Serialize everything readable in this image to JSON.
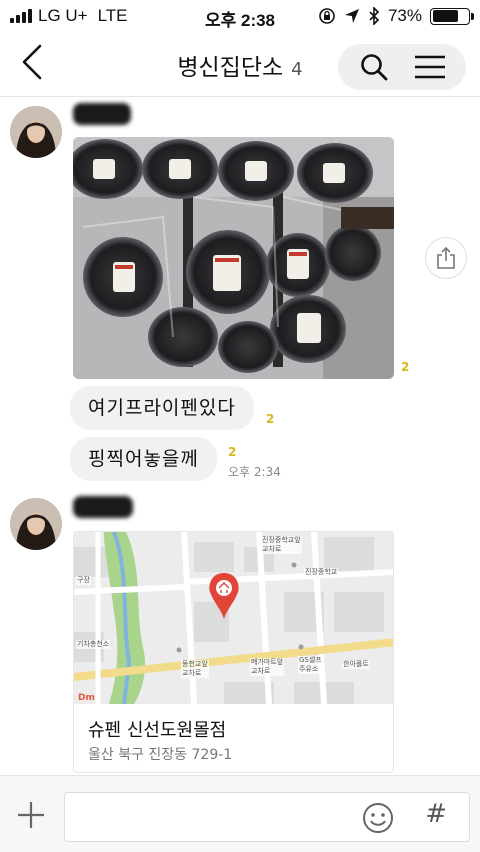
{
  "status_bar": {
    "carrier": "LG U+",
    "network": "LTE",
    "time": "오후 2:38",
    "battery_text": "73%",
    "battery_level": 0.73
  },
  "header": {
    "title": "병신집단소",
    "member_count": "4",
    "icons": [
      "back-arrow-icon",
      "search-icon",
      "menu-icon"
    ]
  },
  "messages": [
    {
      "type": "photo",
      "unread": "2"
    },
    {
      "type": "text",
      "text": "여기프라이펜있다",
      "unread": "2"
    },
    {
      "type": "text",
      "text": "핑찍어놓을께",
      "unread": "2",
      "time": "오후 2:34"
    },
    {
      "type": "location",
      "place": "슈펜 신선도원몰점",
      "address": "울산 북구 진장동 729-1"
    }
  ],
  "map_labels": {
    "top_intersection": "진장중학교앞\n교차로",
    "school": "진장중학교",
    "left_area": "구장",
    "stop": "기차총천소",
    "left_cross": "동천교앞\n교차로",
    "mid_cross": "메가마트앞\n교차로",
    "gs": "GS셀프\n주유소",
    "hanya": "한아폴트"
  },
  "colors": {
    "accent_yellow": "#d8b81a",
    "pin_red": "#e2443a",
    "bubble_bg": "#f1f1f1"
  }
}
